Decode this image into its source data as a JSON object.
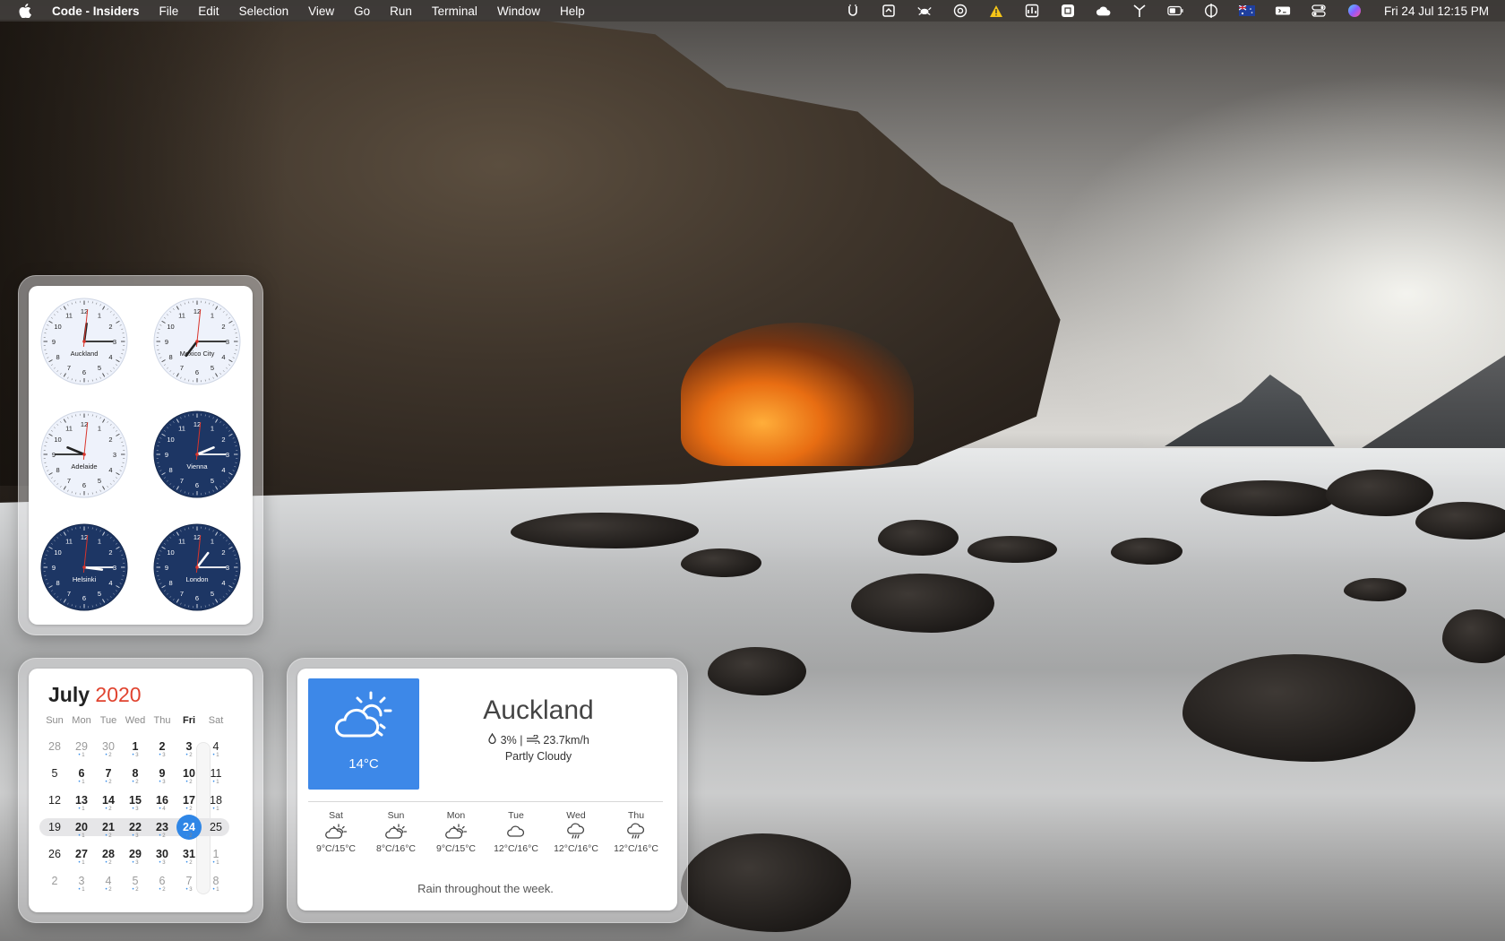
{
  "menubar": {
    "apple_icon": "apple-logo-icon",
    "app_name": "Code - Insiders",
    "menus": [
      "File",
      "Edit",
      "Selection",
      "View",
      "Go",
      "Run",
      "Terminal",
      "Window",
      "Help"
    ],
    "status_icons": [
      "u-glyph-icon",
      "clipboard-icon",
      "crab-icon",
      "at-sign-icon",
      "warning-icon",
      "activity-monitor-icon",
      "command-key-icon",
      "cloud-icon",
      "antenna-icon",
      "battery-icon",
      "dial-icon",
      "australian-flag-icon",
      "control-box-icon",
      "switches-icon",
      "siri-icon"
    ],
    "warning_color": "#f5c518",
    "datetime": "Fri 24 Jul  12:15 PM"
  },
  "clocks": [
    {
      "city": "Auckland",
      "theme": "light",
      "hours": 12,
      "minutes": 15,
      "seconds": 1
    },
    {
      "city": "Mexico City",
      "theme": "light",
      "hours": 7,
      "minutes": 15,
      "seconds": 1
    },
    {
      "city": "Adelaide",
      "theme": "light",
      "hours": 9,
      "minutes": 45,
      "seconds": 1
    },
    {
      "city": "Vienna",
      "theme": "dark",
      "hours": 2,
      "minutes": 15,
      "seconds": 1
    },
    {
      "city": "Helsinki",
      "theme": "dark",
      "hours": 3,
      "minutes": 15,
      "seconds": 1
    },
    {
      "city": "London",
      "theme": "dark",
      "hours": 1,
      "minutes": 15,
      "seconds": 1
    }
  ],
  "clock_colors": {
    "light_face": "#eef2fb",
    "dark_face": "#1d3664",
    "second_hand": "#d9342b"
  },
  "calendar": {
    "month": "July",
    "year": "2020",
    "weekdays": [
      "Sun",
      "Mon",
      "Tue",
      "Wed",
      "Thu",
      "Fri",
      "Sat"
    ],
    "today_weekday_index": 5,
    "accent_color": "#2f86e6",
    "weeks": [
      [
        {
          "n": "28",
          "s": "dim"
        },
        {
          "n": "29",
          "s": "dim",
          "dots": "• 1"
        },
        {
          "n": "30",
          "s": "dim",
          "dots": "• 2"
        },
        {
          "n": "1",
          "s": "bold",
          "dots": "• 3"
        },
        {
          "n": "2",
          "s": "bold",
          "dots": "• 3"
        },
        {
          "n": "3",
          "s": "bold",
          "dots": "• 2"
        },
        {
          "n": "4",
          "s": "normal",
          "dots": "• 1"
        }
      ],
      [
        {
          "n": "5",
          "s": "normal"
        },
        {
          "n": "6",
          "s": "bold",
          "dots": "• 1"
        },
        {
          "n": "7",
          "s": "bold",
          "dots": "• 2"
        },
        {
          "n": "8",
          "s": "bold",
          "dots": "• 2"
        },
        {
          "n": "9",
          "s": "bold",
          "dots": "• 3"
        },
        {
          "n": "10",
          "s": "bold",
          "dots": "• 2"
        },
        {
          "n": "11",
          "s": "normal",
          "dots": "• 1"
        }
      ],
      [
        {
          "n": "12",
          "s": "normal"
        },
        {
          "n": "13",
          "s": "bold",
          "dots": "• 1"
        },
        {
          "n": "14",
          "s": "bold",
          "dots": "• 2"
        },
        {
          "n": "15",
          "s": "bold",
          "dots": "• 3"
        },
        {
          "n": "16",
          "s": "bold",
          "dots": "• 4"
        },
        {
          "n": "17",
          "s": "bold",
          "dots": "• 2"
        },
        {
          "n": "18",
          "s": "normal",
          "dots": "• 1"
        }
      ],
      [
        {
          "n": "19",
          "s": "normal"
        },
        {
          "n": "20",
          "s": "bold",
          "dots": "• 1"
        },
        {
          "n": "21",
          "s": "bold",
          "dots": "• 2"
        },
        {
          "n": "22",
          "s": "bold",
          "dots": "• 3"
        },
        {
          "n": "23",
          "s": "bold",
          "dots": "• 2"
        },
        {
          "n": "24",
          "s": "today",
          "dots": "• 2"
        },
        {
          "n": "25",
          "s": "normal"
        }
      ],
      [
        {
          "n": "26",
          "s": "normal"
        },
        {
          "n": "27",
          "s": "bold",
          "dots": "• 1"
        },
        {
          "n": "28",
          "s": "bold",
          "dots": "• 2"
        },
        {
          "n": "29",
          "s": "bold",
          "dots": "• 3"
        },
        {
          "n": "30",
          "s": "bold",
          "dots": "• 3"
        },
        {
          "n": "31",
          "s": "bold",
          "dots": "• 2"
        },
        {
          "n": "1",
          "s": "dim",
          "dots": "• 1"
        }
      ],
      [
        {
          "n": "2",
          "s": "dim"
        },
        {
          "n": "3",
          "s": "dim",
          "dots": "• 1"
        },
        {
          "n": "4",
          "s": "dim",
          "dots": "• 2"
        },
        {
          "n": "5",
          "s": "dim",
          "dots": "• 2"
        },
        {
          "n": "6",
          "s": "dim",
          "dots": "• 2"
        },
        {
          "n": "7",
          "s": "dim",
          "dots": "• 3"
        },
        {
          "n": "8",
          "s": "dim",
          "dots": "• 1"
        }
      ]
    ],
    "highlighted_week_index": 3
  },
  "weather": {
    "city": "Auckland",
    "current_icon": "partly-cloudy-icon",
    "current_temp": "14°C",
    "precip": "3%",
    "wind": "23.7km/h",
    "separator": "|",
    "condition": "Partly Cloudy",
    "panel_color": "#3d88e8",
    "forecast": [
      {
        "day": "Sat",
        "icon": "partly-cloudy-icon",
        "temps": "9°C/15°C"
      },
      {
        "day": "Sun",
        "icon": "partly-cloudy-icon",
        "temps": "8°C/16°C"
      },
      {
        "day": "Mon",
        "icon": "partly-cloudy-icon",
        "temps": "9°C/15°C"
      },
      {
        "day": "Tue",
        "icon": "cloud-icon",
        "temps": "12°C/16°C"
      },
      {
        "day": "Wed",
        "icon": "rain-icon",
        "temps": "12°C/16°C"
      },
      {
        "day": "Thu",
        "icon": "rain-icon",
        "temps": "12°C/16°C"
      }
    ],
    "summary": "Rain throughout the week."
  }
}
